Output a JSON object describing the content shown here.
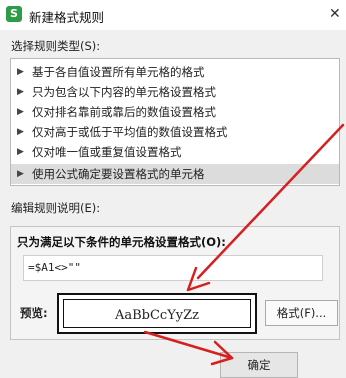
{
  "window": {
    "app_icon_text": "S",
    "title": "新建格式规则",
    "close_symbol": "✕"
  },
  "rule_type_label": "选择规则类型(S):",
  "rule_types": [
    {
      "label": "基于各自值设置所有单元格的格式",
      "selected": false
    },
    {
      "label": "只为包含以下内容的单元格设置格式",
      "selected": false
    },
    {
      "label": "仅对排名靠前或靠后的数值设置格式",
      "selected": false
    },
    {
      "label": "仅对高于或低于平均值的数值设置格式",
      "selected": false
    },
    {
      "label": "仅对唯一值或重复值设置格式",
      "selected": false
    },
    {
      "label": "使用公式确定要设置格式的单元格",
      "selected": true
    }
  ],
  "edit_label": "编辑规则说明(E):",
  "condition_title": "只为满足以下条件的单元格设置格式(O):",
  "formula_value": "=$A1<>\"\"",
  "preview_label": "预览:",
  "preview_text": "AaBbCcYyZz",
  "format_button": "格式(F)...",
  "ok_button": "确定",
  "colors": {
    "arrow": "#d62020",
    "selected_row": "#dcdcdc"
  },
  "icons": {
    "list_bullet": "triangle-right-icon"
  }
}
